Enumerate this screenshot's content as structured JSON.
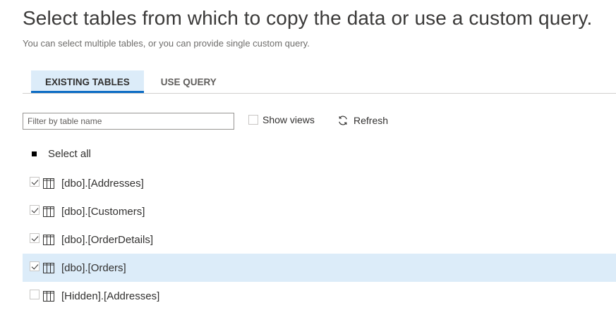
{
  "header": {
    "title": "Select tables from which to copy the data or use a custom query.",
    "subtitle": "You can select multiple tables, or you can provide single custom query."
  },
  "tabs": [
    {
      "label": "EXISTING TABLES",
      "active": true
    },
    {
      "label": "USE QUERY",
      "active": false
    }
  ],
  "filter": {
    "placeholder": "Filter by table name",
    "value": ""
  },
  "show_views": {
    "label": "Show views",
    "checked": false
  },
  "refresh": {
    "label": "Refresh",
    "icon": "refresh-icon"
  },
  "select_all": {
    "label": "Select all",
    "state": "partial"
  },
  "tables": [
    {
      "label": "[dbo].[Addresses]",
      "checked": true,
      "selected": false
    },
    {
      "label": "[dbo].[Customers]",
      "checked": true,
      "selected": false
    },
    {
      "label": "[dbo].[OrderDetails]",
      "checked": true,
      "selected": false
    },
    {
      "label": "[dbo].[Orders]",
      "checked": true,
      "selected": true
    },
    {
      "label": "[Hidden].[Addresses]",
      "checked": false,
      "selected": false
    }
  ],
  "colors": {
    "accent": "#0a6bc4",
    "selected_row": "#dcecf9",
    "active_tab_bg": "#dcecf9"
  }
}
